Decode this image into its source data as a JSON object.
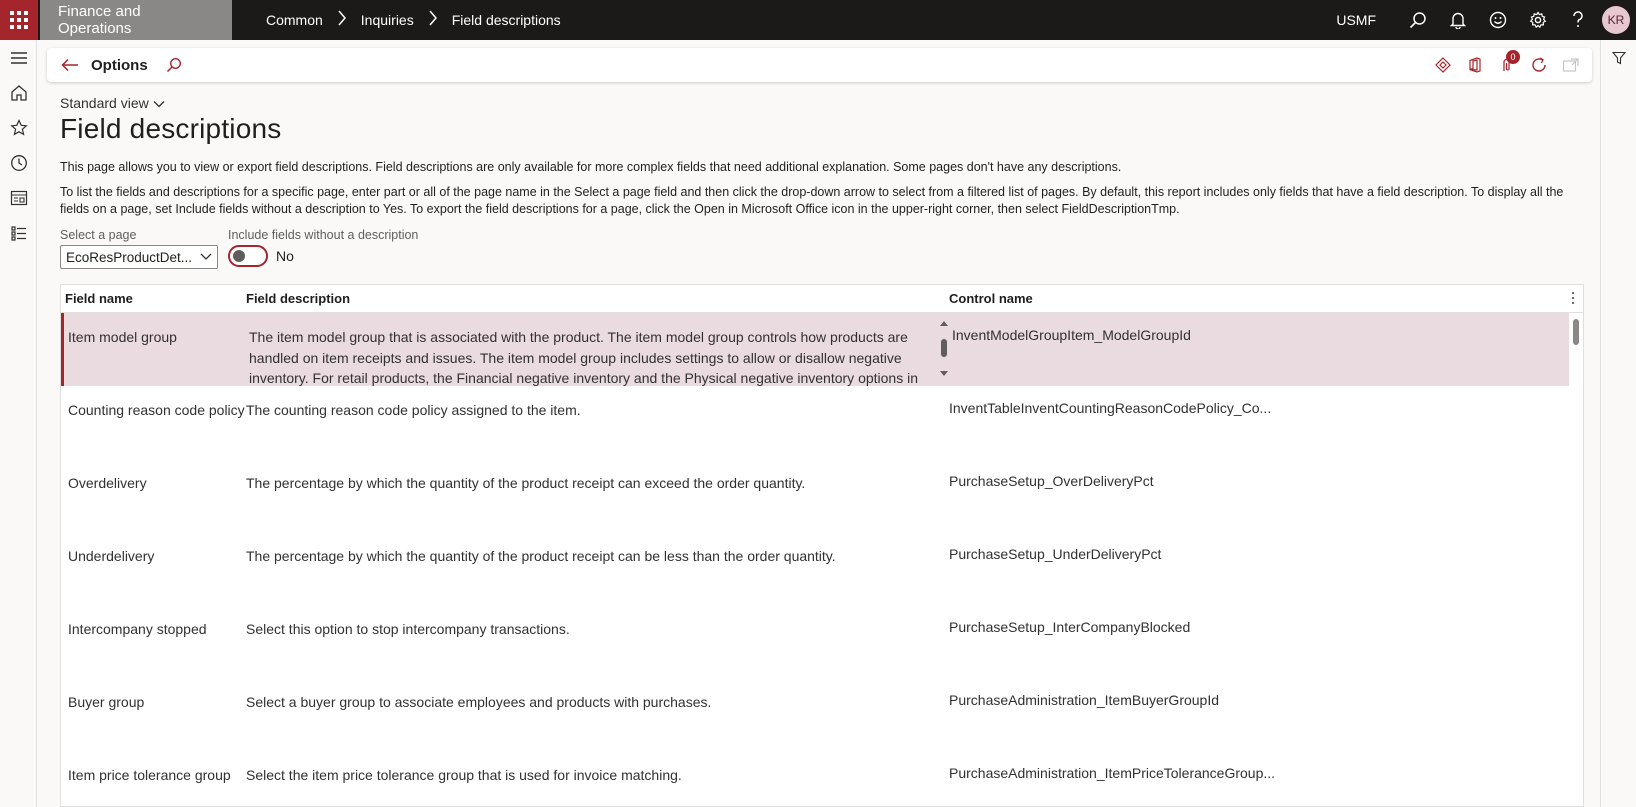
{
  "topbar": {
    "app_name": "Finance and Operations",
    "breadcrumb": [
      "Common",
      "Inquiries",
      "Field descriptions"
    ],
    "company": "USMF",
    "user_initials": "KR"
  },
  "actionpane": {
    "title": "Options"
  },
  "page": {
    "view_name": "Standard view",
    "title": "Field descriptions",
    "help_text_1": "This page allows you to view or export field descriptions. Field descriptions are only available for more complex fields that need additional explanation. Some pages don't have any descriptions.",
    "help_text_2": "To list the fields and descriptions for a specific page, enter part or all of the page name in the Select a page field and then click the drop-down arrow to select from a filtered list of pages. By default, this report includes only fields that have a field description. To display all the fields on a page, set Include fields without a description to Yes. To export the field descriptions for a page, click the Open in Microsoft Office icon in the upper-right corner, then select FieldDescriptionTmp."
  },
  "filters": {
    "select_page_label": "Select a page",
    "select_page_value": "EcoResProductDet...",
    "include_label": "Include fields without a description",
    "include_value": "No"
  },
  "grid": {
    "columns": [
      "Field name",
      "Field description",
      "Control name"
    ],
    "rows": [
      {
        "field": "Item model group",
        "description": "The item model group that is associated with the product. The item model group controls how products are handled on item receipts and issues. The item model group includes settings to allow or disallow negative inventory. For retail products, the Financial negative inventory and the Physical negative inventory options in",
        "control": "InventModelGroupItem_ModelGroupId"
      },
      {
        "field": "Counting reason code policy",
        "description": "The counting reason code policy assigned to the item.",
        "control": "InventTableInventCountingReasonCodePolicy_Co..."
      },
      {
        "field": "Overdelivery",
        "description": "The percentage by which the quantity of the product receipt can exceed the order quantity.",
        "control": "PurchaseSetup_OverDeliveryPct"
      },
      {
        "field": "Underdelivery",
        "description": "The percentage by which the quantity of the product receipt can be less than the order quantity.",
        "control": "PurchaseSetup_UnderDeliveryPct"
      },
      {
        "field": "Intercompany stopped",
        "description": "Select this option to stop intercompany transactions.",
        "control": "PurchaseSetup_InterCompanyBlocked"
      },
      {
        "field": "Buyer group",
        "description": "Select a buyer group to associate employees and products with purchases.",
        "control": "PurchaseAdministration_ItemBuyerGroupId"
      },
      {
        "field": "Item price tolerance group",
        "description": "Select the item price tolerance group that is used for invoice matching.",
        "control": "PurchaseAdministration_ItemPriceToleranceGroup..."
      }
    ]
  },
  "colors": {
    "accent": "#a4262c",
    "topbar": "#1b1a19",
    "selected_row": "#eadbe1"
  }
}
